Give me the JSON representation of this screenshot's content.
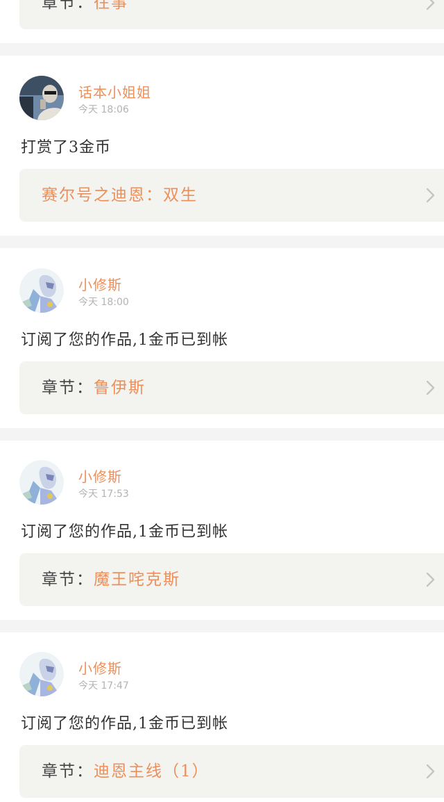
{
  "accent_color": "#ec8f5a",
  "top_partial": {
    "chapter_prefix": "章节：",
    "chapter_title": "往事"
  },
  "notifications": [
    {
      "username": "话本小姐姐",
      "time": "今天 18:06",
      "message": "打赏了3金币",
      "chapter_prefix": "",
      "chapter_title": "赛尔号之迪恩：双生",
      "avatar_icon": "person-photo-avatar"
    },
    {
      "username": "小修斯",
      "time": "今天 18:00",
      "message": "订阅了您的作品,1金币已到帐",
      "chapter_prefix": "章节：",
      "chapter_title": "鲁伊斯",
      "avatar_icon": "anime-character-avatar"
    },
    {
      "username": "小修斯",
      "time": "今天 17:53",
      "message": "订阅了您的作品,1金币已到帐",
      "chapter_prefix": "章节：",
      "chapter_title": "魔王咤克斯",
      "avatar_icon": "anime-character-avatar"
    },
    {
      "username": "小修斯",
      "time": "今天 17:47",
      "message": "订阅了您的作品,1金币已到帐",
      "chapter_prefix": "章节：",
      "chapter_title": "迪恩主线（1）",
      "avatar_icon": "anime-character-avatar"
    }
  ]
}
